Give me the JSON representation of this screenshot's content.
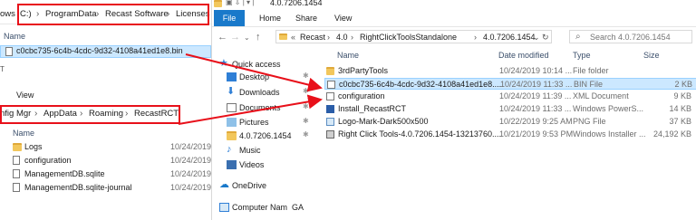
{
  "left_top": {
    "breadcrumb": [
      "ows",
      "C:)",
      "ProgramData",
      "Recast Software",
      "Licenses"
    ],
    "column_name": "Name",
    "selected_file": "c0cbc735-6c4b-4cdc-9d32-4108a41ed1e8.bin"
  },
  "left_bottom": {
    "ribbon_tab": "View",
    "breadcrumb": [
      "nfig Mgr",
      "AppData",
      "Roaming",
      "RecastRCT"
    ],
    "column_name": "Name",
    "files": [
      {
        "name": "Logs",
        "icon": "folder-icon",
        "date": "10/24/2019"
      },
      {
        "name": "configuration",
        "icon": "config-icon",
        "date": "10/24/2019"
      },
      {
        "name": "ManagementDB.sqlite",
        "icon": "document-icon",
        "date": "10/24/2019"
      },
      {
        "name": "ManagementDB.sqlite-journal",
        "icon": "document-icon",
        "date": "10/24/2019"
      }
    ]
  },
  "right": {
    "title": "4.0.7206.1454",
    "ribbon_tabs": {
      "file": "File",
      "home": "Home",
      "share": "Share",
      "view": "View"
    },
    "address": [
      "Recast",
      "4.0",
      "RightClickToolsStandalone",
      "4.0.7206.1454"
    ],
    "address_prefix": "«",
    "search_placeholder": "Search 4.0.7206.1454",
    "nav": [
      {
        "label": "Quick access",
        "icon": "star-icon"
      },
      {
        "label": "Desktop",
        "icon": "desktop-icon",
        "pinned": true
      },
      {
        "label": "Downloads",
        "icon": "download-icon",
        "pinned": true
      },
      {
        "label": "Documents",
        "icon": "documents-icon",
        "pinned": true
      },
      {
        "label": "Pictures",
        "icon": "pictures-icon",
        "pinned": true
      },
      {
        "label": "4.0.7206.1454",
        "icon": "folder-icon",
        "pinned": true
      },
      {
        "label": "Music",
        "icon": "music-icon"
      },
      {
        "label": "Videos",
        "icon": "videos-icon"
      },
      {
        "label": "OneDrive",
        "icon": "cloud-icon"
      },
      {
        "label": "Computer Nam",
        "icon": "computer-icon",
        "suffix": "GA"
      }
    ],
    "columns": {
      "name": "Name",
      "date": "Date modified",
      "type": "Type",
      "size": "Size"
    },
    "files": [
      {
        "name": "3rdPartyTools",
        "date": "10/24/2019 10:14 ...",
        "type": "File folder",
        "size": "",
        "icon": "folder-icon"
      },
      {
        "name": "c0cbc735-6c4b-4cdc-9d32-4108a41ed1e8....",
        "date": "10/24/2019 11:33 ...",
        "type": "BIN File",
        "size": "2 KB",
        "icon": "document-icon",
        "selected": true
      },
      {
        "name": "configuration",
        "date": "10/24/2019 11:39 ...",
        "type": "XML Document",
        "size": "9 KB",
        "icon": "xml-icon"
      },
      {
        "name": "Install_RecastRCT",
        "date": "10/24/2019 11:33 ...",
        "type": "Windows PowerS...",
        "size": "14 KB",
        "icon": "powershell-icon"
      },
      {
        "name": "Logo-Mark-Dark500x500",
        "date": "10/22/2019 9:25 AM",
        "type": "PNG File",
        "size": "37 KB",
        "icon": "image-icon"
      },
      {
        "name": "Right Click Tools-4.0.7206.1454-13213760....",
        "date": "10/21/2019 9:53 PM",
        "type": "Windows Installer ...",
        "size": "24,192 KB",
        "icon": "installer-icon"
      }
    ]
  },
  "colors": {
    "arrow": "#e8101a",
    "file_tab": "#1979ca",
    "selection": "#cce8ff"
  }
}
